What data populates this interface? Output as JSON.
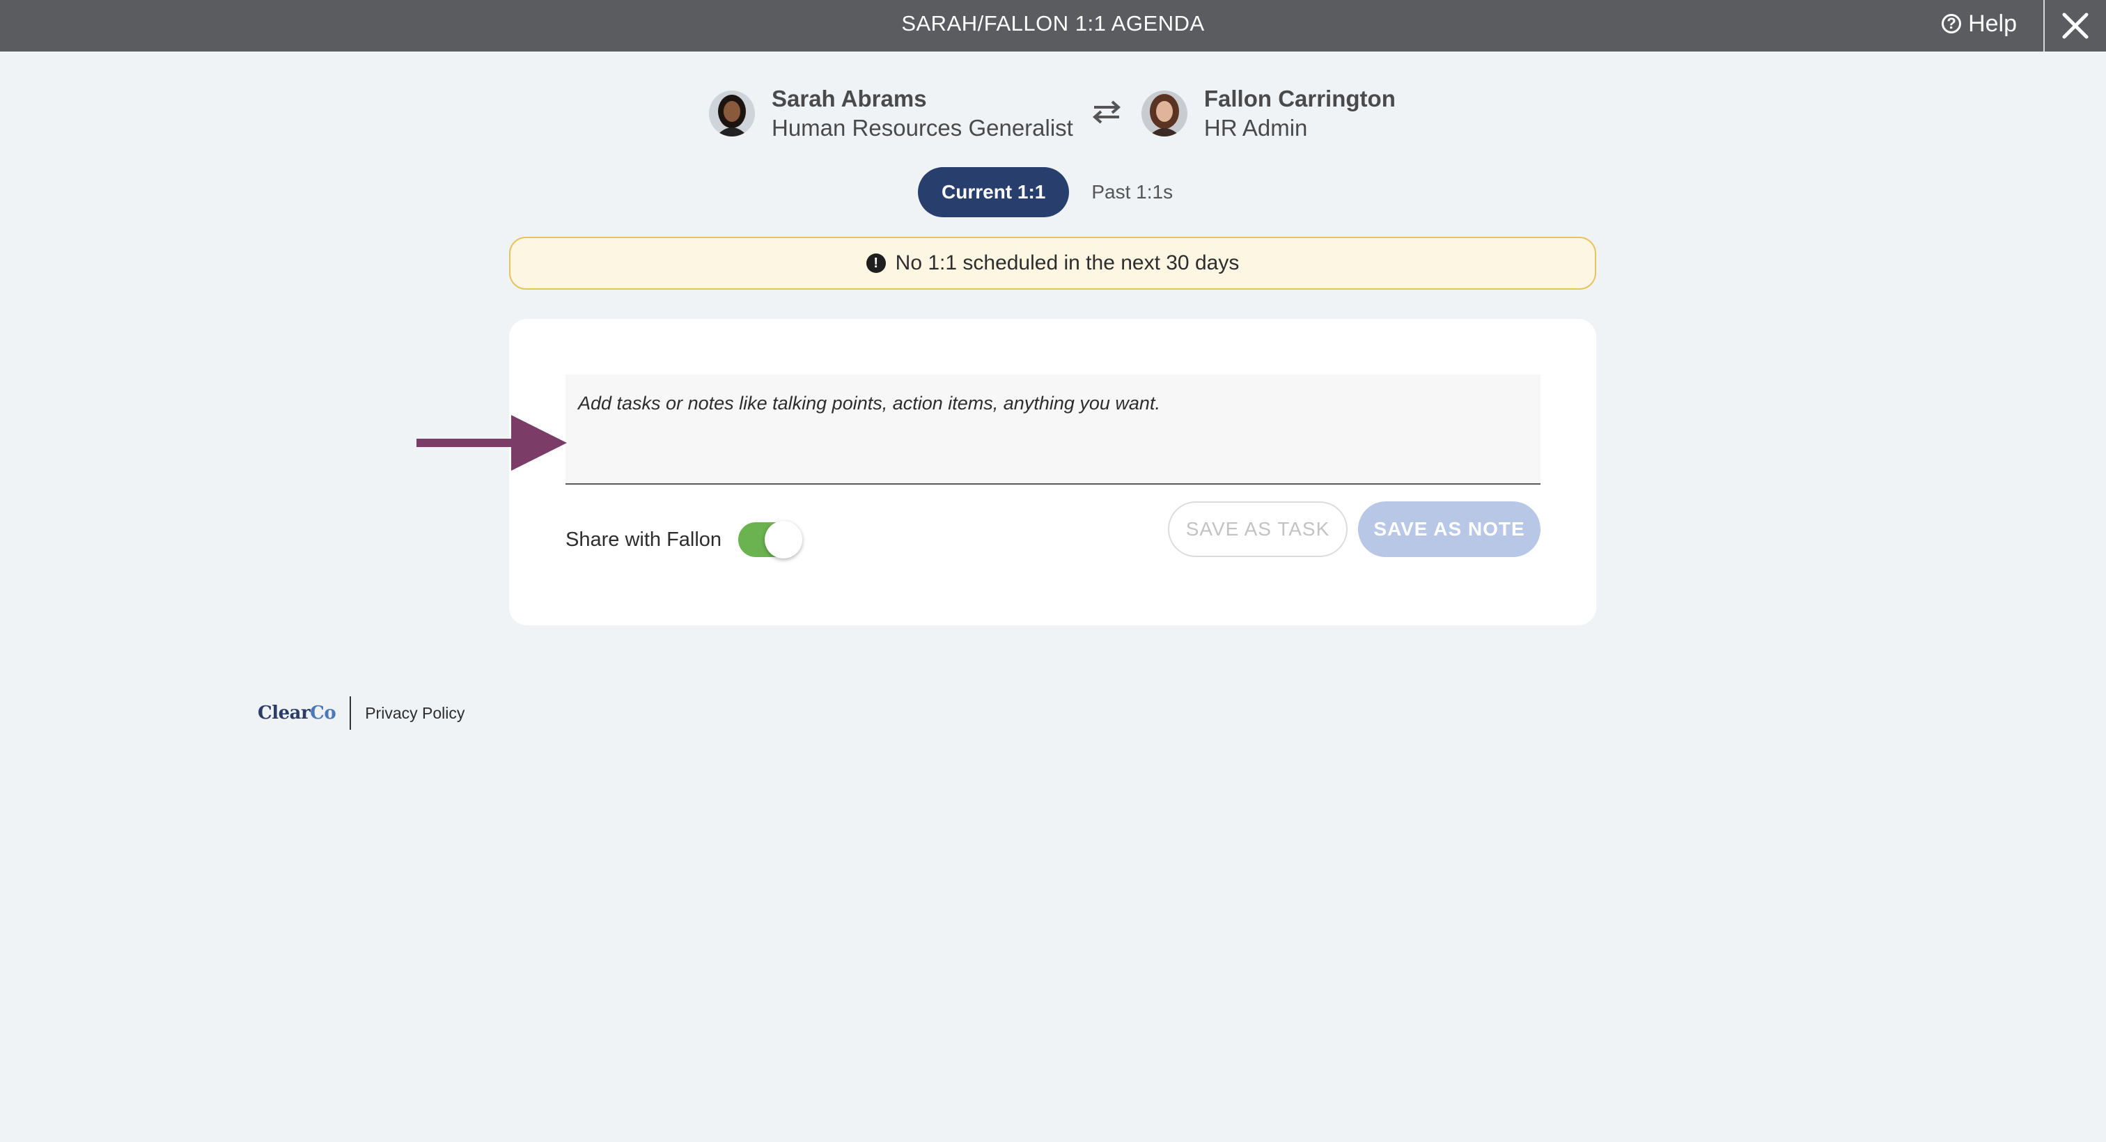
{
  "header": {
    "title": "SARAH/FALLON 1:1 AGENDA",
    "help_label": "Help",
    "help_icon": "question-circle-icon",
    "close_icon": "close-icon"
  },
  "people": {
    "left": {
      "name": "Sarah Abrams",
      "role": "Human Resources Generalist"
    },
    "right": {
      "name": "Fallon Carrington",
      "role": "HR Admin"
    },
    "swap_icon": "swap-arrows-icon"
  },
  "tabs": {
    "current": "Current 1:1",
    "past": "Past 1:1s"
  },
  "alert": {
    "icon_glyph": "!",
    "message": "No 1:1 scheduled in the next 30 days"
  },
  "editor": {
    "placeholder": "Add tasks or notes like talking points, action items, anything you want.",
    "value": "",
    "share_label": "Share with Fallon",
    "share_enabled": true,
    "save_task_label": "SAVE AS TASK",
    "save_note_label": "SAVE AS NOTE"
  },
  "footer": {
    "logo_main": "Clear",
    "logo_accent": "Co",
    "privacy_label": "Privacy Policy"
  },
  "colors": {
    "header_bg": "#5b5c5f",
    "tab_active": "#283f6e",
    "alert_bg": "#fdf6e3",
    "alert_border": "#e8c35a",
    "toggle_on": "#6bb251",
    "save_note_bg": "#b8c7e6",
    "annotation_arrow": "#7b3c67"
  }
}
